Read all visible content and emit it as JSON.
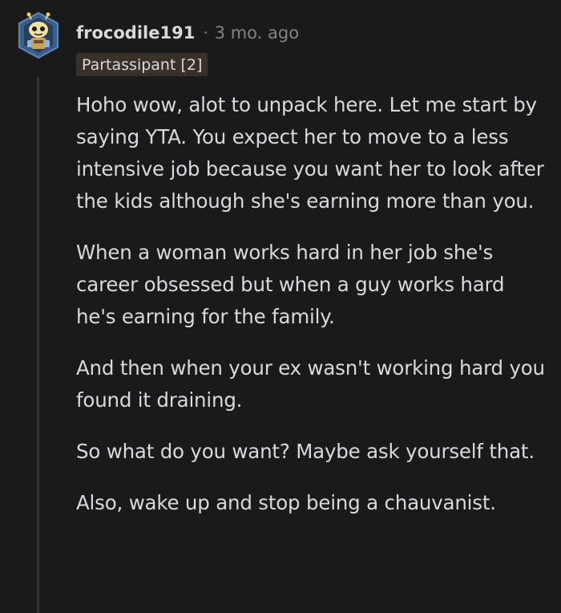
{
  "comment": {
    "author": "frocodile191",
    "separator": "·",
    "timestamp": "3 mo. ago",
    "flair": "Partassipant [2]",
    "avatar_icon": "snoo-avatar-icon",
    "paragraphs": [
      "Hoho wow, alot to unpack here. Let me start by saying YTA. You expect her to move to a less intensive job because you want her to look after the kids although she's earning more than you.",
      "When a woman works hard in her job she's career obsessed but when a guy works hard he's earning for the family.",
      "And then when your ex wasn't working hard you found it draining.",
      "So what do you want? Maybe ask yourself that.",
      "Also, wake up and stop being a chauvanist."
    ]
  },
  "colors": {
    "background": "#1a1a1b",
    "text": "#d7dadc",
    "muted": "#818384",
    "flair_bg": "#3a302a",
    "thread_line": "#343536"
  }
}
